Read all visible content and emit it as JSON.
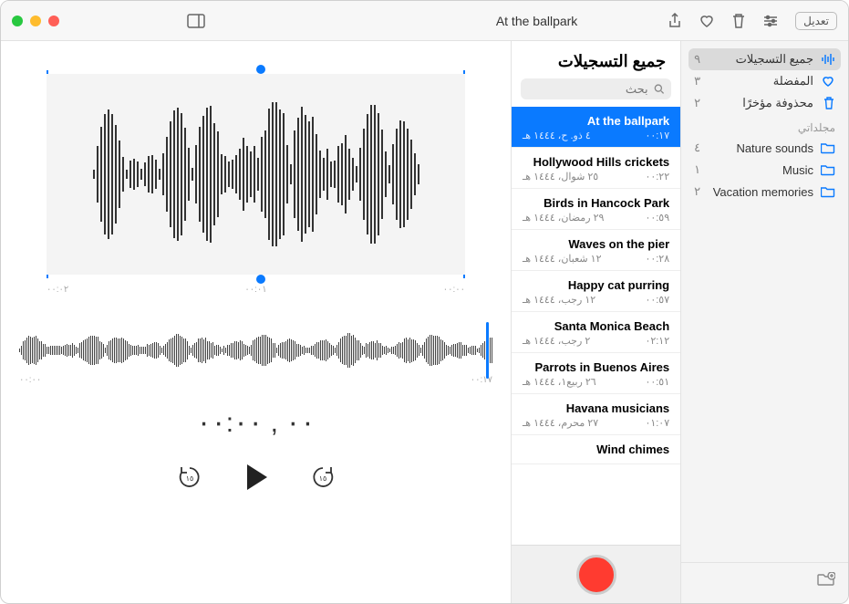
{
  "window": {
    "title": "At the ballpark"
  },
  "toolbar": {
    "edit_label": "تعديل",
    "sidebar_toggle": "sidebar-toggle",
    "share": "share",
    "favorite": "favorite",
    "delete": "delete",
    "settings": "settings"
  },
  "sidebar": {
    "items": [
      {
        "icon": "waveform",
        "label": "جميع التسجيلات",
        "count": "٩",
        "selected": true
      },
      {
        "icon": "heart",
        "label": "المفضلة",
        "count": "٣"
      },
      {
        "icon": "trash",
        "label": "محذوفة مؤخرًا",
        "count": "٢"
      }
    ],
    "folders_header": "مجلداتي",
    "folders": [
      {
        "label": "Nature sounds",
        "count": "٤"
      },
      {
        "label": "Music",
        "count": "١"
      },
      {
        "label": "Vacation memories",
        "count": "٢"
      }
    ]
  },
  "list": {
    "header": "جميع التسجيلات",
    "search_placeholder": "بحث",
    "recordings": [
      {
        "title": "At the ballpark",
        "date": "٤ ذو. ح، ١٤٤٤ هـ",
        "duration": "٠٠:١٧",
        "selected": true
      },
      {
        "title": "Hollywood Hills crickets",
        "date": "٢٥ شوال، ١٤٤٤ هـ",
        "duration": "٠٠:٢٢"
      },
      {
        "title": "Birds in Hancock Park",
        "date": "٢٩ رمضان، ١٤٤٤ هـ",
        "duration": "٠٠:٥٩"
      },
      {
        "title": "Waves on the pier",
        "date": "١٢ شعبان، ١٤٤٤ هـ",
        "duration": "٠٠:٢٨"
      },
      {
        "title": "Happy cat purring",
        "date": "١٢ رجب، ١٤٤٤ هـ",
        "duration": "٠٠:٥٧"
      },
      {
        "title": "Santa Monica Beach",
        "date": "٢ رجب، ١٤٤٤ هـ",
        "duration": "٠٢:١٢"
      },
      {
        "title": "Parrots in Buenos Aires",
        "date": "٢٦ ربيع١، ١٤٤٤ هـ",
        "duration": "٠٠:٥١"
      },
      {
        "title": "Havana musicians",
        "date": "٢٧ محرم، ١٤٤٤ هـ",
        "duration": "٠١:٠٧"
      },
      {
        "title": "Wind chimes",
        "date": "",
        "duration": ""
      }
    ]
  },
  "detail": {
    "ruler": [
      "٠٠:٠٢",
      "٠٠:٠١",
      "٠٠:٠٠"
    ],
    "mini_start": "٠٠:١٧",
    "mini_end": "٠٠:٠٠",
    "current_time": "٠٠ , ٠٠:٠٠"
  }
}
